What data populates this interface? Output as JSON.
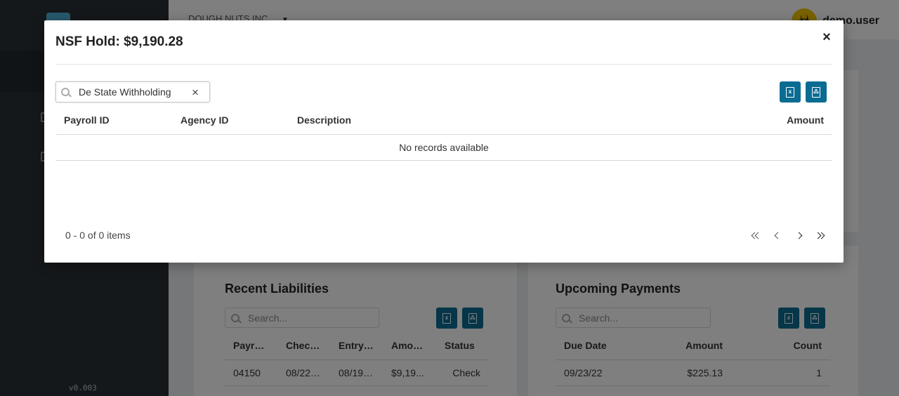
{
  "app": {
    "version": "v0.003",
    "company": "DOUGH NUTS INC.",
    "username": "demo.user"
  },
  "recent_liabilities": {
    "title": "Recent Liabilities",
    "search_placeholder": "Search...",
    "columns": [
      "Payrol...",
      "Check...",
      "Entry ...",
      "Amount",
      "Status"
    ],
    "rows": [
      [
        "04150",
        "08/22/22",
        "08/19/22",
        "$9,19...",
        "Check"
      ]
    ]
  },
  "upcoming_payments": {
    "title": "Upcoming Payments",
    "search_placeholder": "Search...",
    "columns": [
      "Due Date",
      "Amount",
      "Count"
    ],
    "rows": [
      [
        "09/23/22",
        "$225.13",
        "1"
      ]
    ]
  },
  "modal": {
    "title": "NSF Hold: $9,190.28",
    "close_glyph": "×",
    "search_value": "De State Withholding",
    "clear_glyph": "×",
    "excel_glyph": "x",
    "pdf_glyph": "⁂",
    "columns": {
      "payroll_id": "Payroll ID",
      "agency_id": "Agency ID",
      "description": "Description",
      "amount": "Amount"
    },
    "empty_message": "No records available",
    "pager_info": "0 - 0 of 0 items"
  },
  "icons": {
    "user_avatar": "biohazard-icon",
    "company_caret": "caret-down-icon",
    "search": "search-icon",
    "excel": "file-excel-icon",
    "pdf": "file-pdf-icon",
    "close": "close-icon",
    "first": "first-page-icon",
    "prev": "previous-page-icon",
    "next": "next-page-icon",
    "last": "last-page-icon"
  },
  "colors": {
    "accent": "#0b6c93",
    "sidebar": "#2b3035",
    "avatar": "#f2c400",
    "overlay": "rgba(0,0,0,0.5)"
  }
}
